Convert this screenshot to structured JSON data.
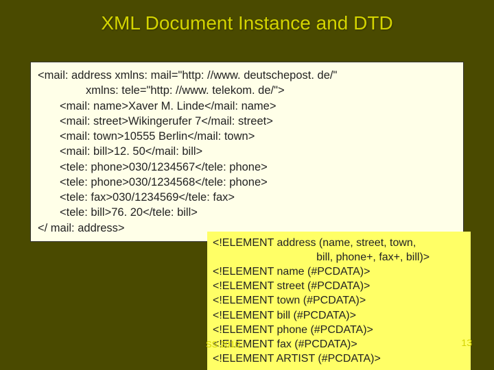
{
  "title": "XML Document Instance and DTD",
  "xml": {
    "l1": "<mail: address xmlns: mail=\"http: //www. deutschepost. de/\"",
    "l2": "xmlns: tele=\"http: //www. telekom. de/\">",
    "l3": "<mail: name>Xaver M. Linde</mail: name>",
    "l4": "<mail: street>Wikingerufer 7</mail: street>",
    "l5": "<mail: town>10555 Berlin</mail: town>",
    "l6": "<mail: bill>12. 50</mail: bill>",
    "l7": "<tele: phone>030/1234567</tele: phone>",
    "l8": "<tele: phone>030/1234568</tele: phone>",
    "l9": "<tele: fax>030/1234569</tele: fax>",
    "l10": "<tele: bill>76. 20</tele: bill>",
    "l11": "</ mail: address>"
  },
  "dtd": {
    "d1": "<!ELEMENT address (name, street, town,",
    "d2": "                                  bill, phone+, fax+, bill)>",
    "d3": "<!ELEMENT name (#PCDATA)>",
    "d4": "<!ELEMENT street (#PCDATA)>",
    "d5": "<!ELEMENT town (#PCDATA)>",
    "d6": "<!ELEMENT bill (#PCDATA)>",
    "d7": "<!ELEMENT phone (#PCDATA)>",
    "d8": "<!ELEMENT fax (#PCDATA)>",
    "d9": "<!ELEMENT ARTIST (#PCDATA)>"
  },
  "footer_fragment": "SS 2010",
  "page_number": "13"
}
